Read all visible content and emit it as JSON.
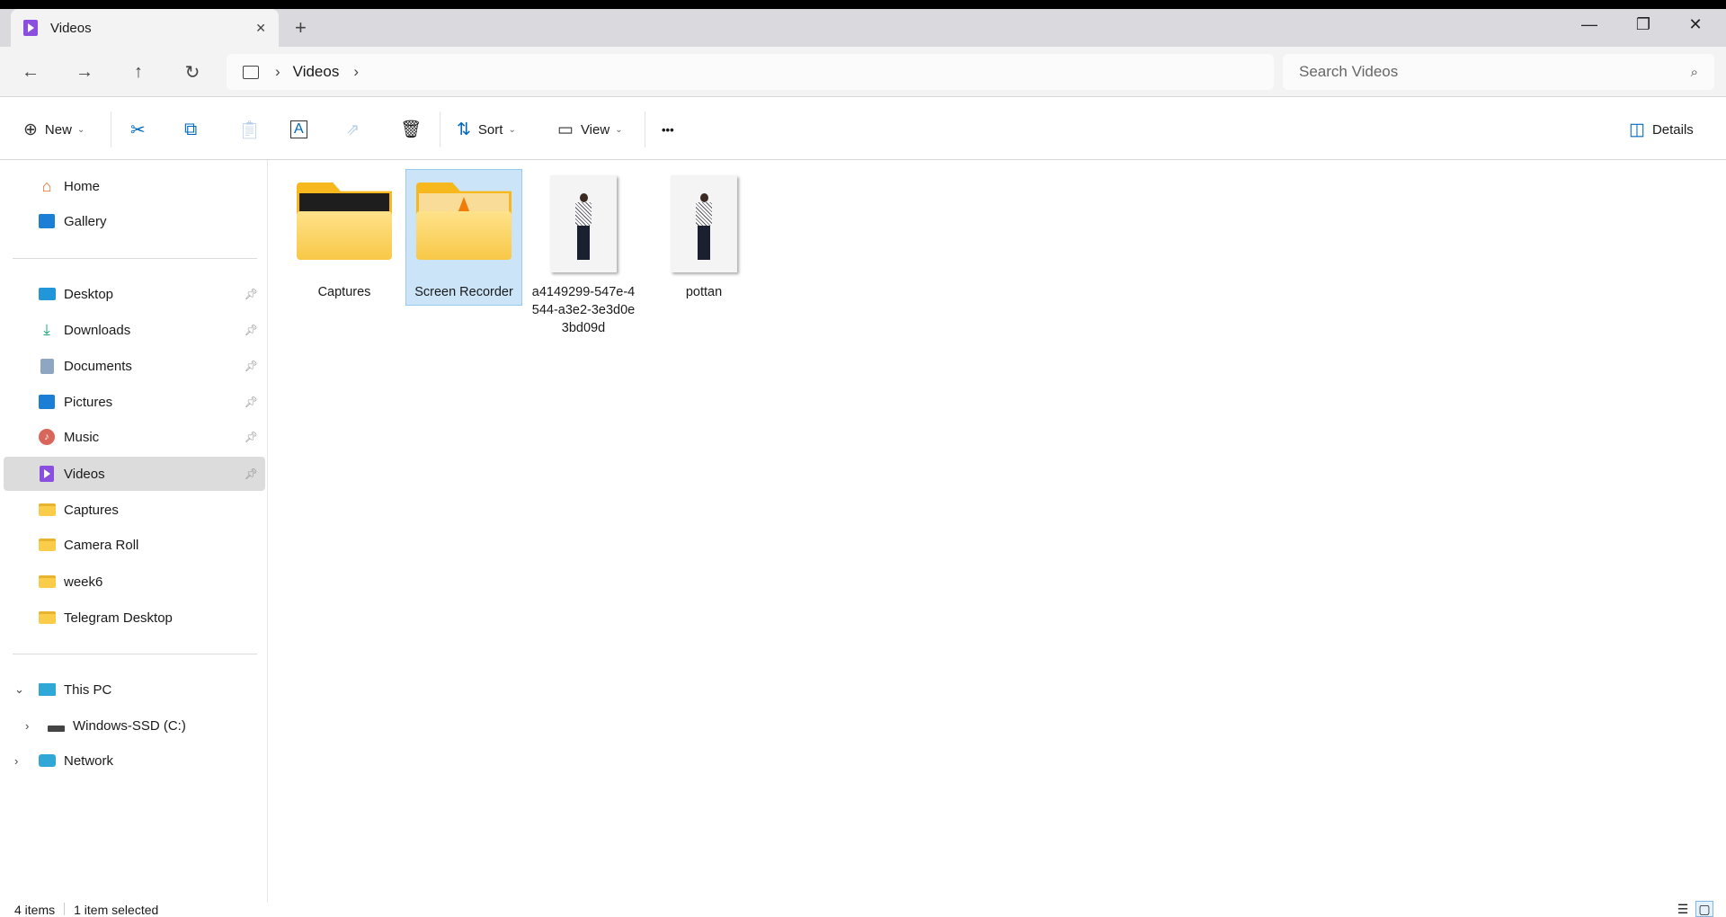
{
  "window": {
    "tab_title": "Videos",
    "new_tab": "+",
    "minimize": "—",
    "restore": "❐",
    "close": "✕",
    "tab_close": "✕"
  },
  "nav": {
    "back": "←",
    "forward": "→",
    "up": "↑",
    "refresh": "↻",
    "breadcrumb": [
      "Videos"
    ],
    "search_placeholder": "Search Videos"
  },
  "toolbar": {
    "new_label": "New",
    "sort_label": "Sort",
    "view_label": "View",
    "more": "•••",
    "details_label": "Details"
  },
  "sidebar": {
    "top": [
      {
        "label": "Home"
      },
      {
        "label": "Gallery"
      }
    ],
    "quick": [
      {
        "label": "Desktop",
        "pinned": true
      },
      {
        "label": "Downloads",
        "pinned": true
      },
      {
        "label": "Documents",
        "pinned": true
      },
      {
        "label": "Pictures",
        "pinned": true
      },
      {
        "label": "Music",
        "pinned": true
      },
      {
        "label": "Videos",
        "pinned": true,
        "selected": true
      },
      {
        "label": "Captures"
      },
      {
        "label": "Camera Roll"
      },
      {
        "label": "week6"
      },
      {
        "label": "Telegram Desktop"
      }
    ],
    "tree": [
      {
        "label": "This PC",
        "expanded": true
      },
      {
        "label": "Windows-SSD (C:)"
      },
      {
        "label": "Network"
      }
    ]
  },
  "content": {
    "items": [
      {
        "name": "Captures",
        "type": "folder"
      },
      {
        "name": "Screen Recorder",
        "type": "folder",
        "selected": true
      },
      {
        "name": "a4149299-547e-4544-a3e2-3e3d0e3bd09d",
        "type": "image"
      },
      {
        "name": "pottan",
        "type": "image"
      }
    ]
  },
  "status": {
    "count": "4 items",
    "selection": "1 item selected"
  },
  "colors": {
    "accent": "#0067c0",
    "selection": "#cce4f7",
    "folder": "#f8c847"
  }
}
